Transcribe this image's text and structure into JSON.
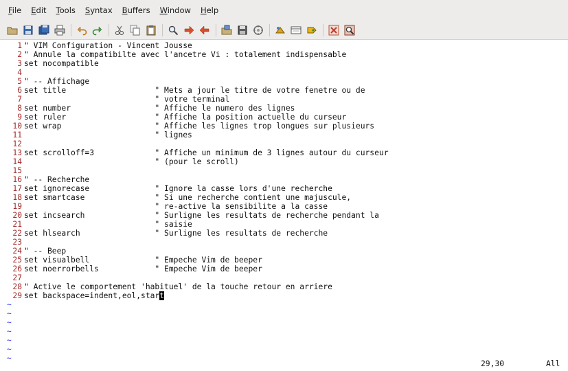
{
  "menubar": {
    "items": [
      {
        "key": "F",
        "rest": "ile"
      },
      {
        "key": "E",
        "rest": "dit"
      },
      {
        "key": "T",
        "rest": "ools"
      },
      {
        "key": "S",
        "rest": "yntax"
      },
      {
        "key": "B",
        "rest": "uffers"
      },
      {
        "key": "W",
        "rest": "indow"
      },
      {
        "key": "H",
        "rest": "elp"
      }
    ]
  },
  "toolbar": {
    "groups": [
      [
        "open-icon",
        "save-icon",
        "save-all-icon",
        "print-icon"
      ],
      [
        "undo-icon",
        "redo-icon"
      ],
      [
        "cut-icon",
        "copy-icon",
        "paste-icon"
      ],
      [
        "find-icon",
        "find-next-icon",
        "find-prev-icon"
      ],
      [
        "load-session-icon",
        "save-session-icon",
        "run-script-icon"
      ],
      [
        "make-icon",
        "shell-icon",
        "ctags-icon"
      ],
      [
        "help-icon",
        "find-help-icon"
      ]
    ]
  },
  "colors": {
    "line_number": "#a52a2a",
    "tilde": "#3a3aff",
    "text": "#111111",
    "bar_bg": "#edeceb"
  },
  "editor": {
    "lines": [
      {
        "n": "1",
        "text": "\" VIM Configuration - Vincent Jousse"
      },
      {
        "n": "2",
        "text": "\" Annule la compatibilte avec l'ancetre Vi : totalement indispensable"
      },
      {
        "n": "3",
        "text": "set nocompatible"
      },
      {
        "n": "4",
        "text": ""
      },
      {
        "n": "5",
        "text": "\" -- Affichage"
      },
      {
        "n": "6",
        "text": "set title                   \" Mets a jour le titre de votre fenetre ou de"
      },
      {
        "n": "7",
        "text": "                            \" votre terminal"
      },
      {
        "n": "8",
        "text": "set number                  \" Affiche le numero des lignes"
      },
      {
        "n": "9",
        "text": "set ruler                   \" Affiche la position actuelle du curseur"
      },
      {
        "n": "10",
        "text": "set wrap                    \" Affiche les lignes trop longues sur plusieurs"
      },
      {
        "n": "11",
        "text": "                            \" lignes"
      },
      {
        "n": "12",
        "text": ""
      },
      {
        "n": "13",
        "text": "set scrolloff=3             \" Affiche un minimum de 3 lignes autour du curseur"
      },
      {
        "n": "14",
        "text": "                            \" (pour le scroll)"
      },
      {
        "n": "15",
        "text": ""
      },
      {
        "n": "16",
        "text": "\" -- Recherche"
      },
      {
        "n": "17",
        "text": "set ignorecase              \" Ignore la casse lors d'une recherche"
      },
      {
        "n": "18",
        "text": "set smartcase               \" Si une recherche contient une majuscule,"
      },
      {
        "n": "19",
        "text": "                            \" re-active la sensibilite a la casse"
      },
      {
        "n": "20",
        "text": "set incsearch               \" Surligne les resultats de recherche pendant la"
      },
      {
        "n": "21",
        "text": "                            \" saisie"
      },
      {
        "n": "22",
        "text": "set hlsearch                \" Surligne les resultats de recherche"
      },
      {
        "n": "23",
        "text": ""
      },
      {
        "n": "24",
        "text": "\" -- Beep"
      },
      {
        "n": "25",
        "text": "set visualbell              \" Empeche Vim de beeper"
      },
      {
        "n": "26",
        "text": "set noerrorbells            \" Empeche Vim de beeper"
      },
      {
        "n": "27",
        "text": ""
      },
      {
        "n": "28",
        "text": "\" Active le comportement 'habituel' de la touche retour en arriere"
      },
      {
        "n": "29",
        "text": "set backspace=indent,eol,start"
      }
    ],
    "cursor_line": 29,
    "cursor_char": "t",
    "tildes": [
      "~",
      "~",
      "~",
      "~",
      "~",
      "~",
      "~"
    ]
  },
  "status": {
    "position": "29,30",
    "scroll": "All"
  }
}
